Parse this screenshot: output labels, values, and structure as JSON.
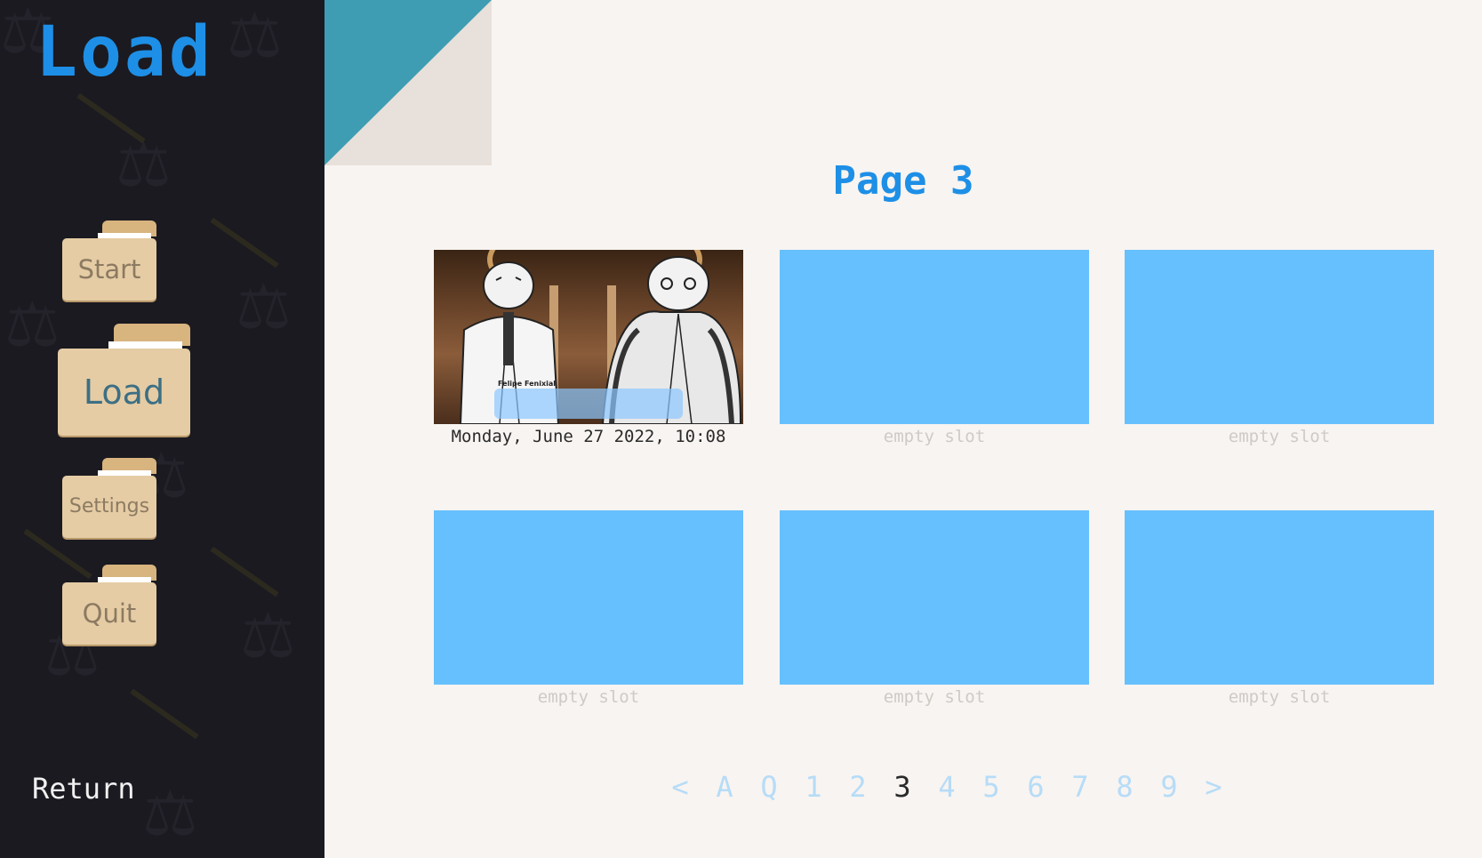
{
  "screen": {
    "title": "Load"
  },
  "nav": {
    "start": "Start",
    "load": "Load",
    "settings": "Settings",
    "quit": "Quit",
    "return": "Return"
  },
  "page": {
    "label": "Page 3"
  },
  "slots": [
    {
      "caption": "Monday, June 27 2022, 10:08",
      "filled": true,
      "thumbnail_text": "Felipe Fenixial"
    },
    {
      "caption": "empty slot",
      "filled": false
    },
    {
      "caption": "empty slot",
      "filled": false
    },
    {
      "caption": "empty slot",
      "filled": false
    },
    {
      "caption": "empty slot",
      "filled": false
    },
    {
      "caption": "empty slot",
      "filled": false
    }
  ],
  "pagination": {
    "prev": "<",
    "auto": "A",
    "quick": "Q",
    "pages": [
      "1",
      "2",
      "3",
      "4",
      "5",
      "6",
      "7",
      "8",
      "9"
    ],
    "current": "3",
    "next": ">"
  },
  "colors": {
    "accent": "#1e8fe6",
    "slot_empty": "#66c0fd",
    "sidebar": "#1b1a21",
    "background": "#f8f4f1",
    "folder": "#e5cca4",
    "corner_teal": "#3e9db2"
  },
  "icons": [
    "folder-icon",
    "scales-of-justice-icon"
  ]
}
